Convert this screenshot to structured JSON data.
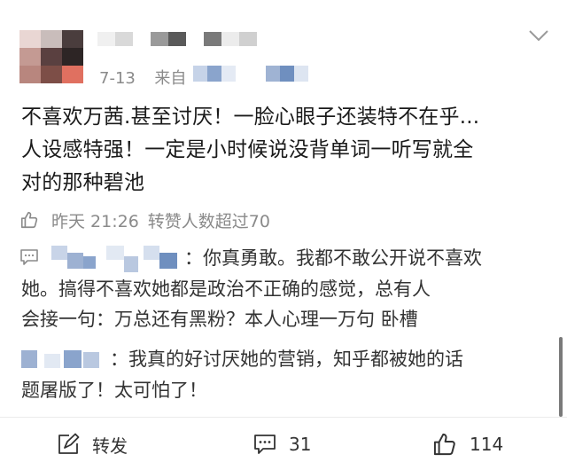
{
  "post": {
    "date": "7-13",
    "source_prefix": "来自",
    "text_lines": [
      "不喜欢万茜.甚至讨厌！一脸心眼子还装特不在乎...",
      "人设感特强！一定是小时候说没背单词一听写就全",
      "对的那种碧池"
    ]
  },
  "comment_meta": {
    "time": "昨天 21:26",
    "likes_note": "转赞人数超过70"
  },
  "replies": [
    {
      "lines": [
        "：你真勇敢。我都不敢公开说不喜欢",
        "她。搞得不喜欢她都是政治不正确的感觉，总有人",
        "会接一句：万总还有黑粉？本人心理一万句 卧槽"
      ]
    },
    {
      "lines": [
        "：我真的好讨厌她的营销，知乎都被她的话",
        "题屠版了！太可怕了！"
      ]
    }
  ],
  "actions": {
    "repost_label": "转发",
    "comment_count": "31",
    "like_count": "114"
  },
  "icons": [
    "chevron-down-icon",
    "thumbs-up-icon",
    "reply-bubble-icon",
    "repost-icon",
    "comment-icon",
    "like-icon"
  ],
  "colors": {
    "meta_gray": "#8a8a8a",
    "text_dark": "#1a1a1a",
    "mosaic_blue": "#8aa4cc"
  }
}
